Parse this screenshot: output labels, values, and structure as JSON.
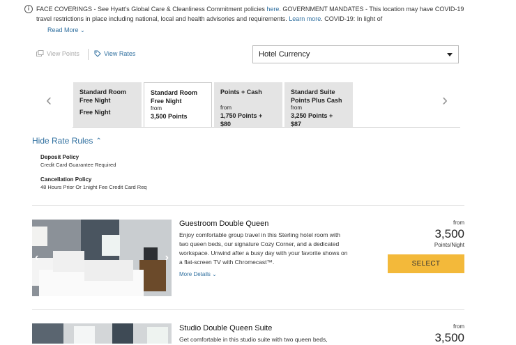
{
  "notice": {
    "part1": "FACE COVERINGS - See Hyatt's Global Care & Cleanliness Commitment policies ",
    "link1": "here",
    "part2": ". GOVERNMENT MANDATES - This location may have COVID-19 travel restrictions in place including national, local and health advisories and requirements. ",
    "link2": "Learn more",
    "part3": ". COVID-19: In light of",
    "read_more": "Read More"
  },
  "toggles": {
    "view_points": "View Points",
    "view_rates": "View Rates"
  },
  "currency": {
    "selected": "Hotel Currency"
  },
  "rate_tabs": [
    {
      "title1": "Standard Room",
      "title2": "Free Night",
      "from": "",
      "value1": "Free Night",
      "value2": "",
      "active": false
    },
    {
      "title1": "Standard Room",
      "title2": "Free Night",
      "from": "from",
      "value1": "3,500 Points",
      "value2": "",
      "active": true
    },
    {
      "title1": "Points + Cash",
      "title2": "",
      "from": "from",
      "value1": "1,750 Points +",
      "value2": "$80",
      "active": false
    },
    {
      "title1": "Standard Suite",
      "title2": "Points Plus Cash",
      "from": "from",
      "value1": "3,250 Points +",
      "value2": "$87",
      "active": false
    }
  ],
  "rate_rules": {
    "toggle": "Hide Rate Rules",
    "deposit_title": "Deposit Policy",
    "deposit_value": "Credit Card Guarantee Required",
    "cancel_title": "Cancellation Policy",
    "cancel_value": "48 Hours Prior Or 1night Fee Credit Card Req"
  },
  "rooms": [
    {
      "title": "Guestroom Double Queen",
      "description": "Enjoy comfortable group travel in this Sterling hotel room with two queen beds, our signature Cozy Corner, and a dedicated workspace. Unwind after a busy day with your favorite shows on a flat-screen TV with Chromecast™.",
      "more": "More Details",
      "from": "from",
      "price": "3,500",
      "unit": "Points/Night",
      "select": "SELECT"
    },
    {
      "title": "Studio Double Queen Suite",
      "description": "Get comfortable in this studio suite with two queen beds,",
      "from": "from",
      "price": "3,500"
    }
  ],
  "colors": {
    "link": "#2f6f9f",
    "select_button": "#f3b93a",
    "tab_inactive": "#e4e4e4"
  }
}
